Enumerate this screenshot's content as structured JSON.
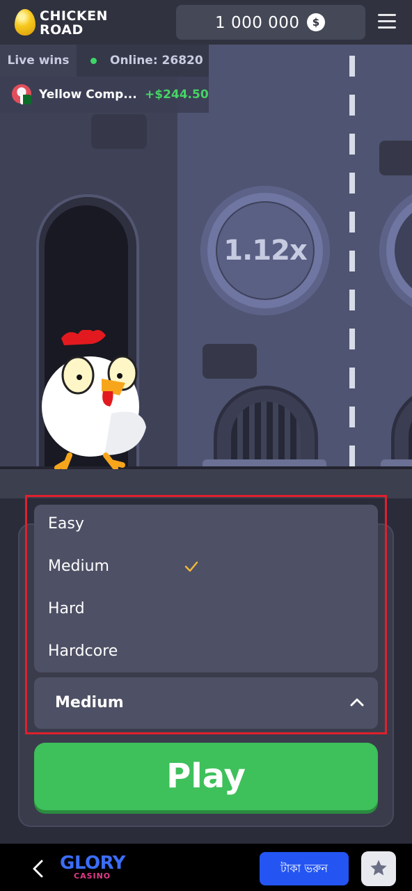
{
  "header": {
    "logo_line1": "CHICKEN",
    "logo_line2": "ROAD",
    "balance": "1 000 000",
    "currency_symbol": "$"
  },
  "live": {
    "label": "Live wins",
    "online": "Online: 26820",
    "winner_name": "Yellow Comp...",
    "winner_amount": "+$244.50"
  },
  "game": {
    "multiplier": "1.12x"
  },
  "difficulty": {
    "options": [
      "Easy",
      "Medium",
      "Hard",
      "Hardcore"
    ],
    "selected": "Medium"
  },
  "play_label": "Play",
  "footer": {
    "brand": "GLORY",
    "brand_sub": "CASINO",
    "deposit_label": "টাকা ভরুন"
  },
  "colors": {
    "play_green": "#3ec05a",
    "highlight_red": "#e0202c",
    "deposit_blue": "#2455f2",
    "win_green": "#47d466"
  }
}
